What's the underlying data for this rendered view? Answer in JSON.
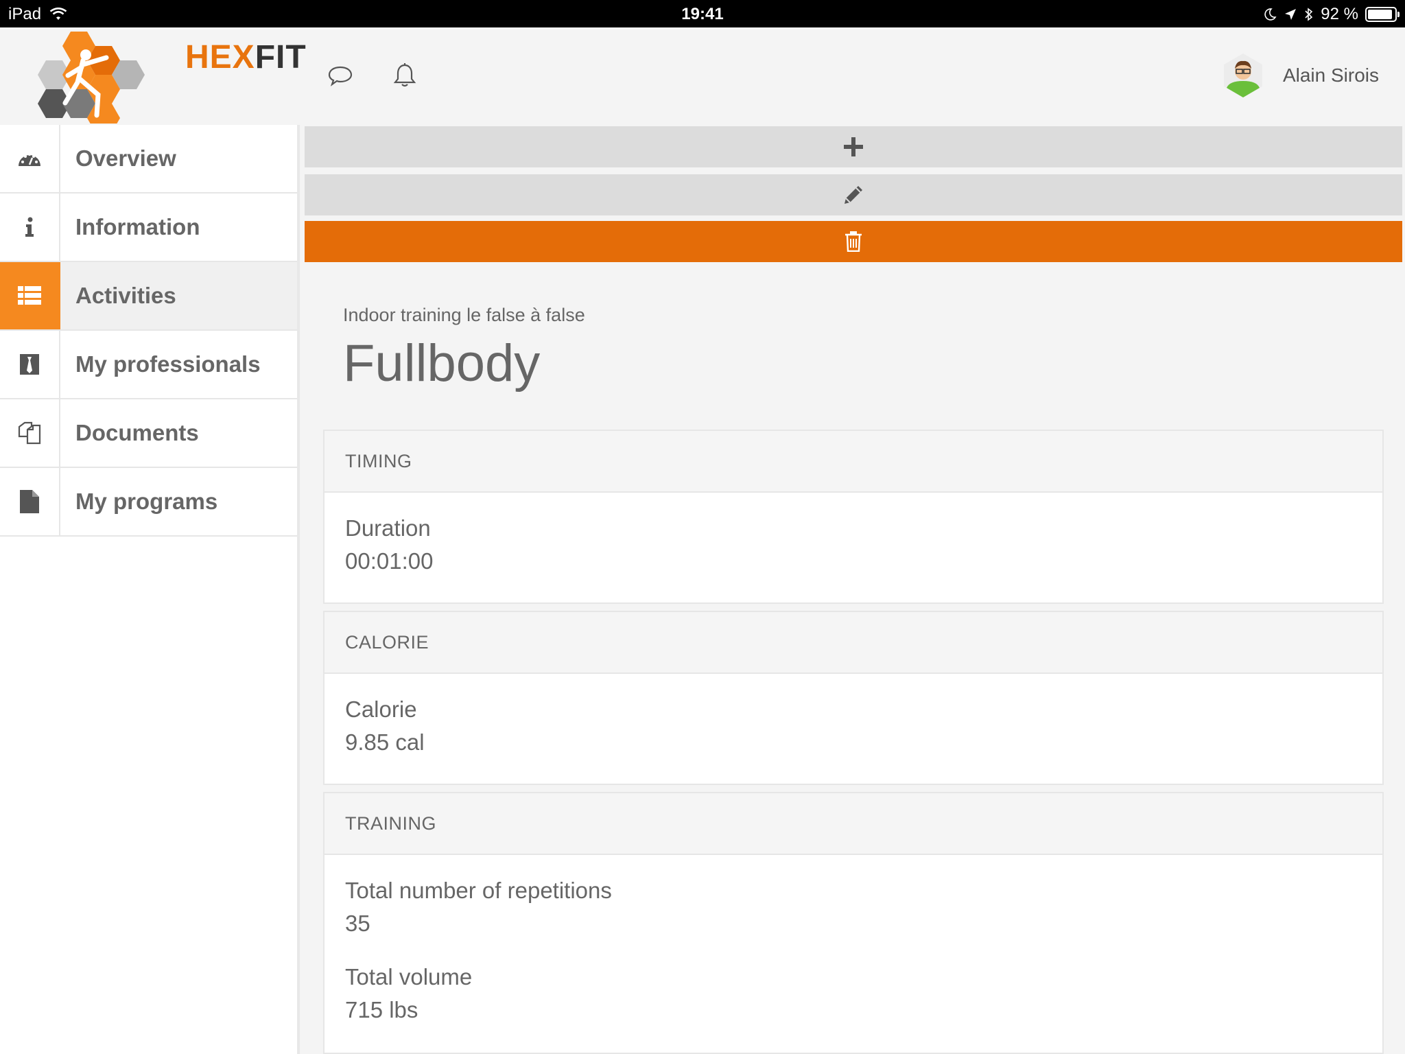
{
  "status_bar": {
    "device": "iPad",
    "time": "19:41",
    "battery": "92 %",
    "battery_level": 0.92
  },
  "header": {
    "logo_hex": "HEX",
    "logo_fit": "FIT",
    "icons": [
      "chat-icon",
      "bell-icon"
    ],
    "user_name": "Alain Sirois"
  },
  "sidebar": {
    "items": [
      {
        "label": "Overview",
        "icon": "dashboard-icon"
      },
      {
        "label": "Information",
        "icon": "info-icon"
      },
      {
        "label": "Activities",
        "icon": "list-icon",
        "active": true
      },
      {
        "label": "My professionals",
        "icon": "tie-icon"
      },
      {
        "label": "Documents",
        "icon": "documents-icon"
      },
      {
        "label": "My programs",
        "icon": "file-icon"
      }
    ]
  },
  "actions": {
    "add": "plus-icon",
    "edit": "pencil-icon",
    "delete": "trash-icon"
  },
  "activity": {
    "subtitle": "Indoor training le false à false",
    "title": "Fullbody"
  },
  "sections": [
    {
      "heading": "TIMING",
      "fields": [
        {
          "label": "Duration",
          "value": "00:01:00"
        }
      ]
    },
    {
      "heading": "CALORIE",
      "fields": [
        {
          "label": "Calorie",
          "value": "9.85 cal"
        }
      ]
    },
    {
      "heading": "TRAINING",
      "fields": [
        {
          "label": "Total number of repetitions",
          "value": "35"
        },
        {
          "label": "Total volume",
          "value": "715 lbs"
        }
      ]
    }
  ],
  "colors": {
    "accent": "#f5891f",
    "delete": "#e46c08",
    "action_gray": "#dcdcdc"
  }
}
